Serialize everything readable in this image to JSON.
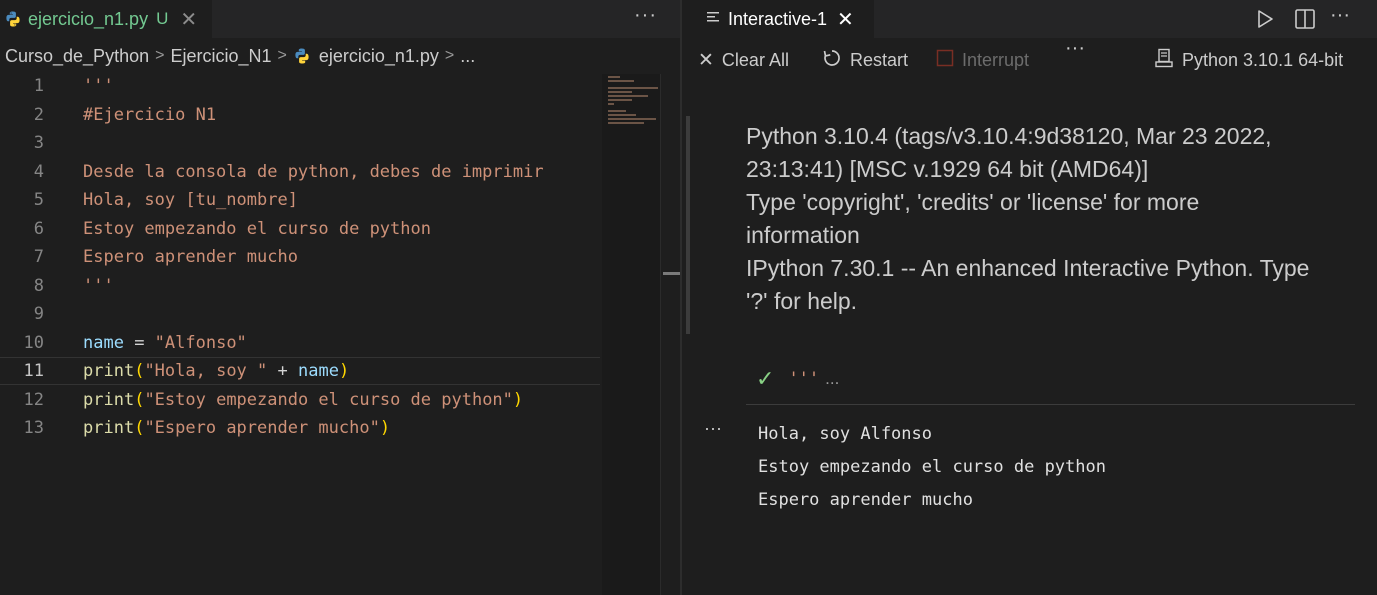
{
  "editor": {
    "tab": {
      "filename": "ejercicio_n1.py",
      "status": "U"
    },
    "breadcrumb": [
      "Curso_de_Python",
      "Ejercicio_N1",
      "ejercicio_n1.py",
      "..."
    ],
    "lines": [
      {
        "n": "1",
        "text": "'''"
      },
      {
        "n": "2",
        "text": "#Ejercicio N1"
      },
      {
        "n": "3",
        "text": ""
      },
      {
        "n": "4",
        "text": "Desde la consola de python, debes de imprimir"
      },
      {
        "n": "5",
        "text": "Hola, soy [tu_nombre]"
      },
      {
        "n": "6",
        "text": "Estoy empezando el curso de python"
      },
      {
        "n": "7",
        "text": "Espero aprender mucho"
      },
      {
        "n": "8",
        "text": "'''"
      },
      {
        "n": "9",
        "text": ""
      },
      {
        "n": "10",
        "var": "name",
        "op": " = ",
        "str": "\"Alfonso\""
      },
      {
        "n": "11",
        "fn": "print",
        "open": "(",
        "str": "\"Hola, soy \"",
        "op": " + ",
        "var": "name",
        "close": ")"
      },
      {
        "n": "12",
        "fn": "print",
        "open": "(",
        "str": "\"Estoy empezando el curso de python\"",
        "close": ")"
      },
      {
        "n": "13",
        "fn": "print",
        "open": "(",
        "str": "\"Espero aprender mucho\"",
        "close": ")"
      }
    ],
    "current_line": "11"
  },
  "interactive": {
    "tab": {
      "title": "Interactive-1"
    },
    "toolbar": {
      "clear_all": "Clear All",
      "restart": "Restart",
      "interrupt": "Interrupt",
      "kernel": "Python 3.10.1 64-bit"
    },
    "banner": [
      "Python 3.10.4 (tags/v3.10.4:9d38120, Mar 23 2022,",
      "23:13:41) [MSC v.1929 64 bit (AMD64)]",
      "Type 'copyright', 'credits' or 'license' for more",
      "information",
      "IPython 7.30.1 -- An enhanced Interactive Python. Type",
      "'?' for help."
    ],
    "cell": {
      "snippet": "'''",
      "ellipsis": "...",
      "output": [
        "Hola, soy Alfonso",
        "Estoy empezando el curso de python",
        "Espero aprender mucho"
      ]
    }
  },
  "colors": {
    "string": "#ce9178",
    "function": "#dcdcaa",
    "variable": "#9cdcfe",
    "modified": "#73c991",
    "success": "#89d185"
  }
}
